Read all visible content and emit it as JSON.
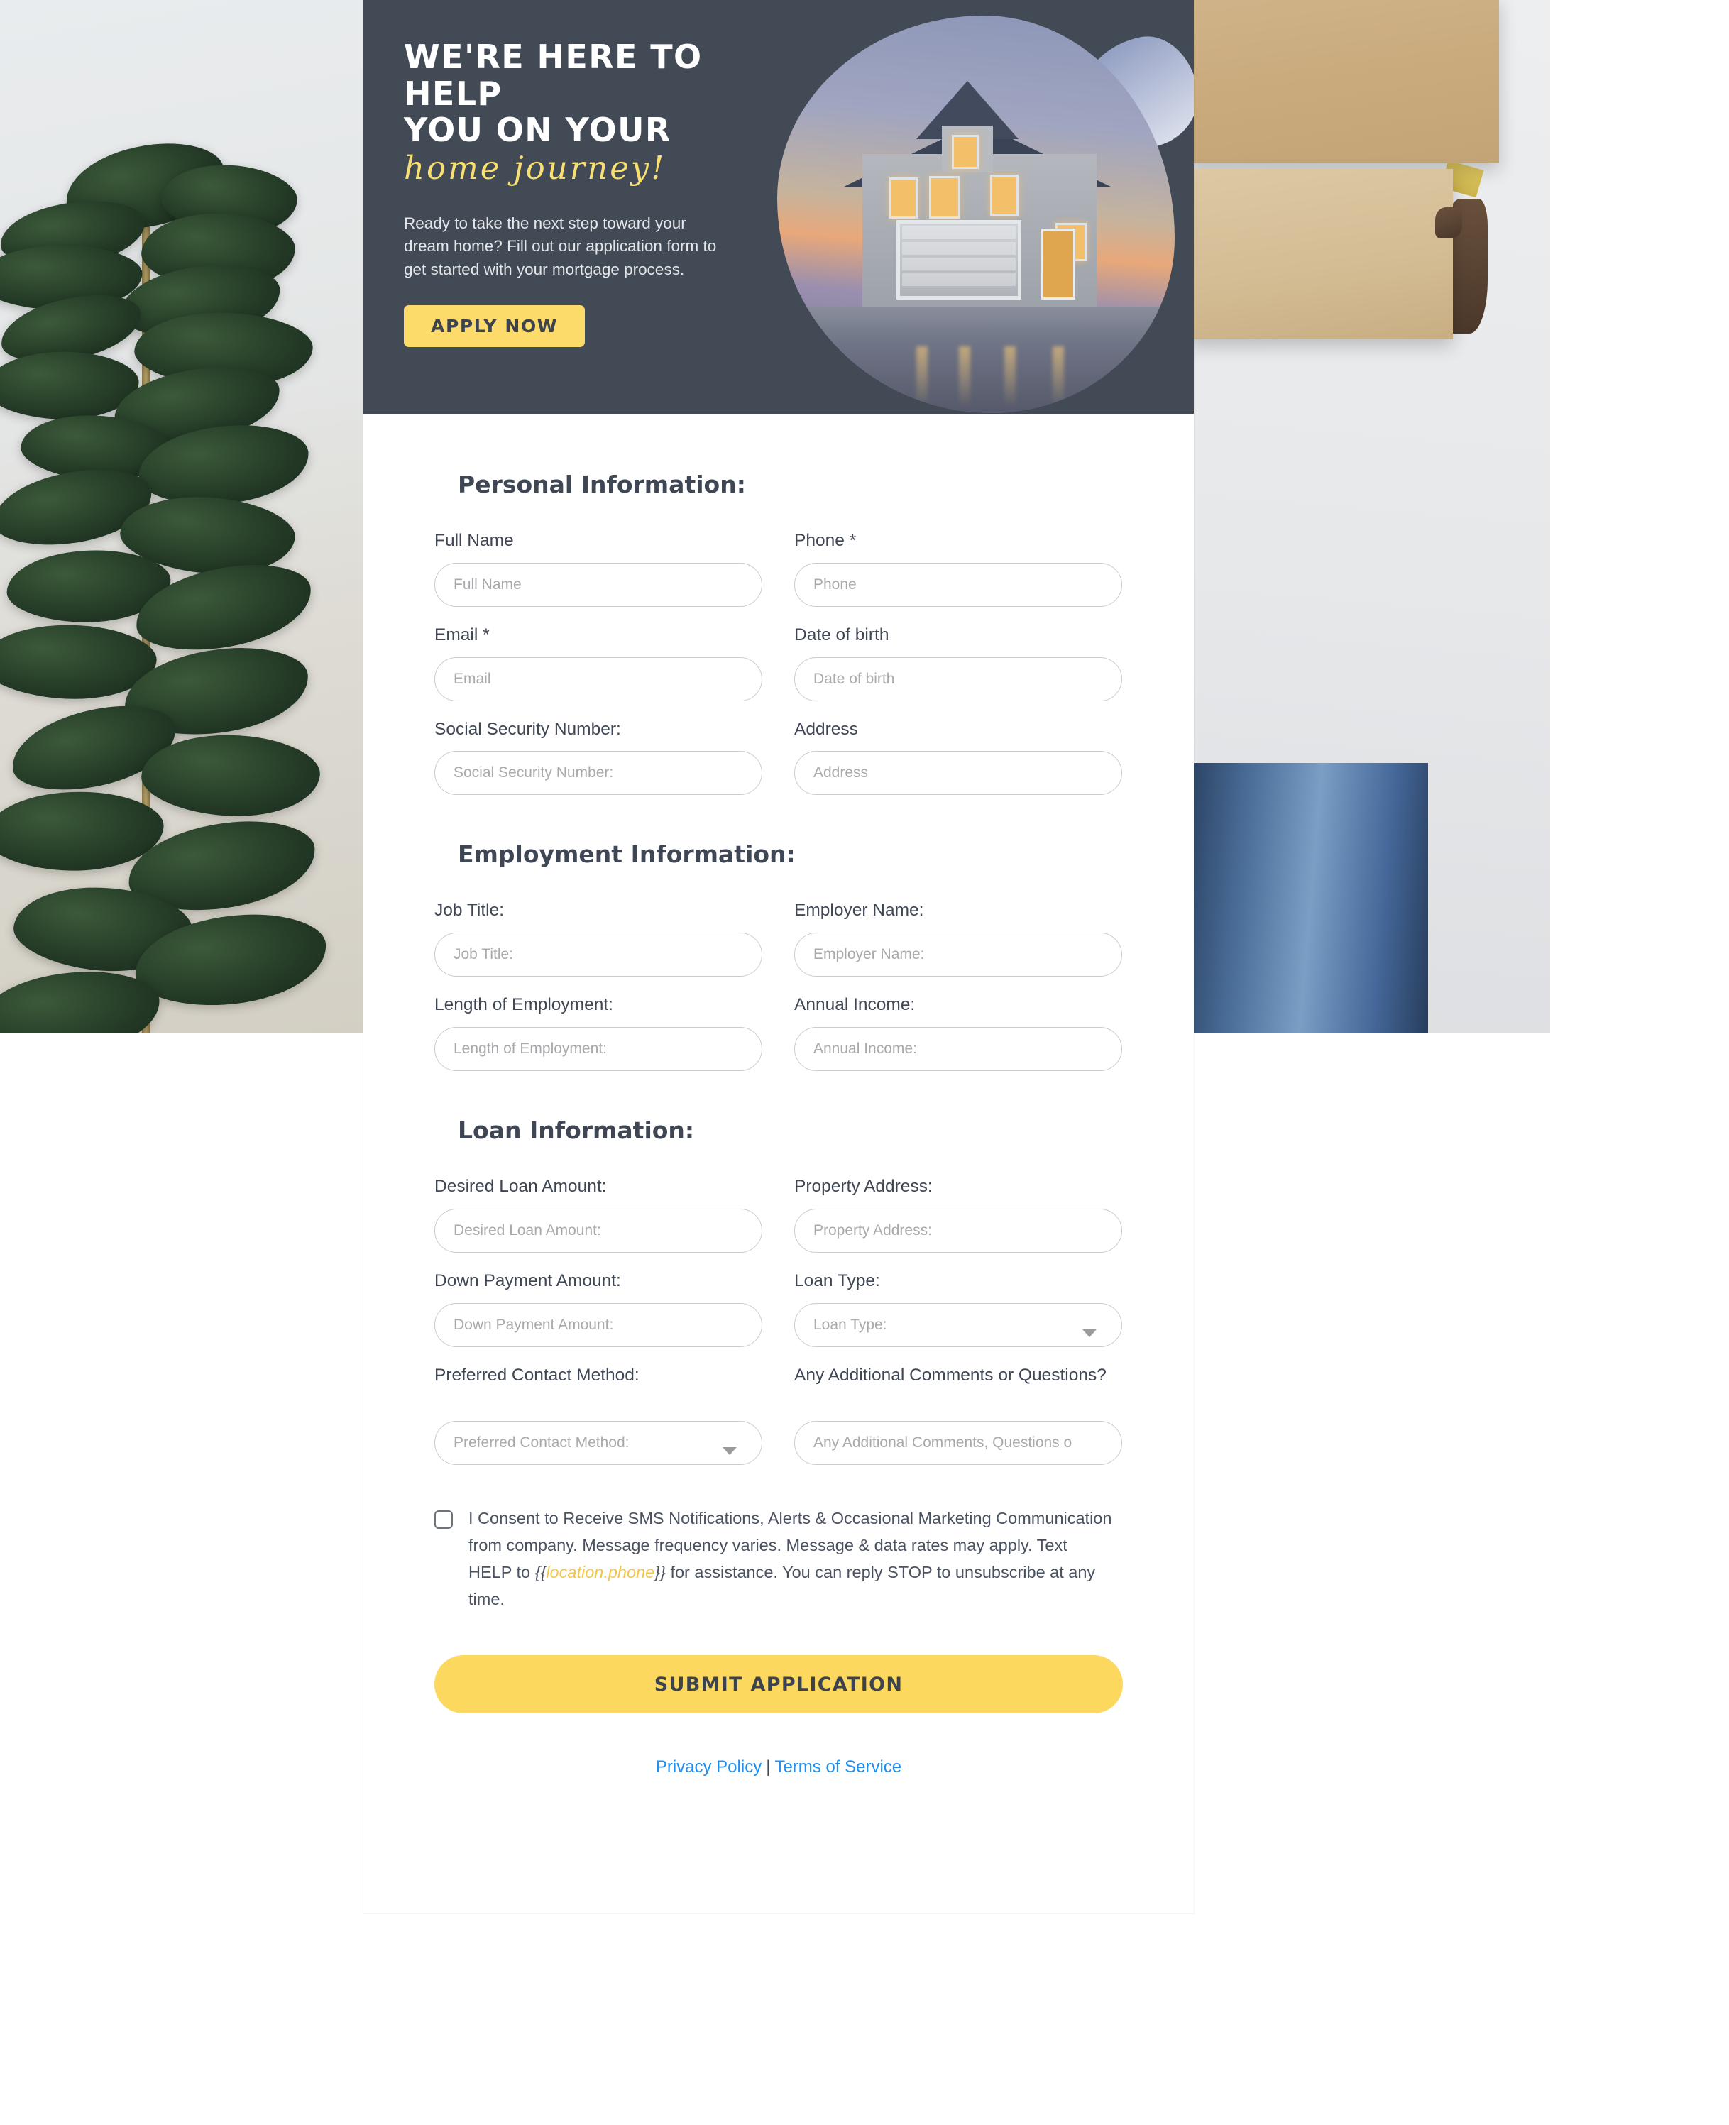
{
  "banner": {
    "headline_line1": "WE'RE HERE TO HELP",
    "headline_line2": "YOU ON YOUR",
    "script_line": "home journey!",
    "subtext": "Ready to take the next step toward your dream home? Fill out our application form to get started with your mortgage process.",
    "cta_label": "APPLY NOW",
    "bg_color": "#424a56",
    "accent_color": "#fcdb6b",
    "script_color": "#f7df72"
  },
  "sections": {
    "personal": {
      "title": "Personal Information:",
      "fields": [
        {
          "label": "Full Name",
          "placeholder": "Full Name"
        },
        {
          "label": "Phone *",
          "placeholder": "Phone"
        },
        {
          "label": "Email *",
          "placeholder": "Email"
        },
        {
          "label": "Date of birth",
          "placeholder": "Date of birth"
        },
        {
          "label": "Social Security Number:",
          "placeholder": "Social Security Number:"
        },
        {
          "label": "Address",
          "placeholder": "Address"
        }
      ]
    },
    "employment": {
      "title": "Employment Information:",
      "fields": [
        {
          "label": "Job Title:",
          "placeholder": "Job Title:"
        },
        {
          "label": "Employer Name:",
          "placeholder": "Employer Name:"
        },
        {
          "label": "Length of Employment:",
          "placeholder": "Length of Employment:"
        },
        {
          "label": "Annual Income:",
          "placeholder": "Annual Income:"
        }
      ]
    },
    "loan": {
      "title": "Loan Information:",
      "fields": [
        {
          "label": "Desired Loan Amount:",
          "placeholder": "Desired Loan Amount:"
        },
        {
          "label": "Property Address:",
          "placeholder": "Property Address:"
        },
        {
          "label": "Down Payment Amount:",
          "placeholder": "Down Payment Amount:"
        },
        {
          "label": "Loan Type:",
          "placeholder": "Loan Type:"
        },
        {
          "label": "Preferred Contact Method:",
          "placeholder": "Preferred Contact Method:"
        },
        {
          "label": "Any Additional Comments or Questions?",
          "placeholder": "Any Additional Comments, Questions o"
        }
      ]
    }
  },
  "consent": {
    "part1": "I Consent to Receive SMS Notifications, Alerts & Occasional Marketing Communication from company. Message frequency varies. Message & data rates may apply. Text HELP to ",
    "merge_open": "{{",
    "merge_token": "location.phone",
    "merge_close": "}}",
    "part2": " for assistance. You can reply STOP to unsubscribe at any time.",
    "checked": false
  },
  "submit": {
    "label": "SUBMIT APPLICATION",
    "color": "#fcd95e"
  },
  "footer": {
    "privacy_label": "Privacy Policy",
    "separator": "|",
    "terms_label": "Terms of Service",
    "link_color": "#1f8ef1"
  }
}
